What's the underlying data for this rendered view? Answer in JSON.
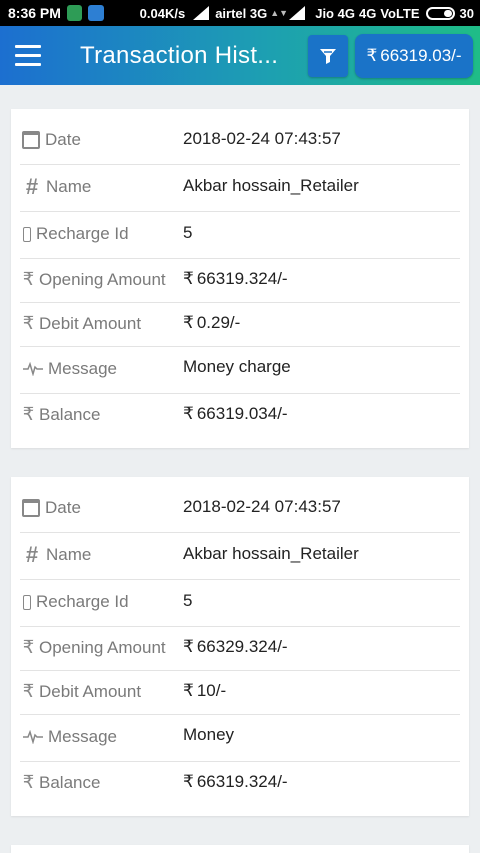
{
  "status_bar": {
    "time": "8:36 PM",
    "speed": "0.04K/s",
    "carrier1": "airtel 3G",
    "carrier2": "Jio 4G",
    "network": "4G",
    "volte": "VoLTE",
    "battery": "30"
  },
  "app_bar": {
    "title": "Transaction Hist...",
    "balance": "66319.03/-"
  },
  "currency_symbol": "₹",
  "transactions": [
    {
      "date_label": "Date",
      "date": "2018-02-24 07:43:57",
      "name_label": "Name",
      "name": "Akbar hossain_Retailer",
      "recharge_label": "Recharge Id",
      "recharge_id": "5",
      "opening_label": "Opening Amount",
      "opening_amount": "66319.324/-",
      "debit_label": "Debit Amount",
      "debit_amount": "0.29/-",
      "message_label": "Message",
      "message": "Money charge",
      "balance_label": "Balance",
      "balance": "66319.034/-"
    },
    {
      "date_label": "Date",
      "date": "2018-02-24 07:43:57",
      "name_label": "Name",
      "name": "Akbar hossain_Retailer",
      "recharge_label": "Recharge Id",
      "recharge_id": "5",
      "opening_label": "Opening Amount",
      "opening_amount": "66329.324/-",
      "debit_label": "Debit Amount",
      "debit_amount": "10/-",
      "message_label": "Message",
      "message": "Money",
      "balance_label": "Balance",
      "balance": "66319.324/-"
    }
  ]
}
